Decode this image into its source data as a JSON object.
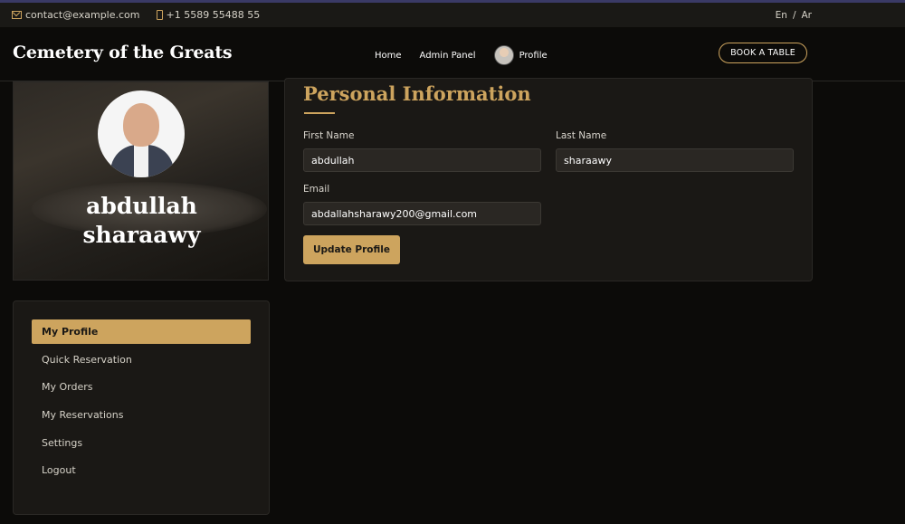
{
  "topbar": {
    "email": "contact@example.com",
    "phone": "+1 5589 55488 55",
    "lang_en": "En",
    "lang_sep": "/",
    "lang_ar": "Ar"
  },
  "nav": {
    "brand": "Cemetery of the Greats",
    "links": [
      "Home",
      "Admin Panel"
    ],
    "profile_label": "Profile",
    "book_button": "BOOK A TABLE"
  },
  "profile": {
    "name_line1": "abdullah",
    "name_line2": "sharaawy"
  },
  "form": {
    "title": "Personal Information",
    "first_name_label": "First Name",
    "first_name_value": "abdullah",
    "last_name_label": "Last Name",
    "last_name_value": "sharaawy",
    "email_label": "Email",
    "email_value": "abdallahsharawy200@gmail.com",
    "submit_label": "Update Profile"
  },
  "menu": {
    "items": [
      {
        "label": "My Profile",
        "active": true
      },
      {
        "label": "Quick Reservation",
        "active": false
      },
      {
        "label": "My Orders",
        "active": false
      },
      {
        "label": "My Reservations",
        "active": false
      },
      {
        "label": "Settings",
        "active": false
      },
      {
        "label": "Logout",
        "active": false
      }
    ]
  },
  "colors": {
    "accent": "#cda45e",
    "background": "#0c0b09",
    "card": "#1a1815"
  }
}
